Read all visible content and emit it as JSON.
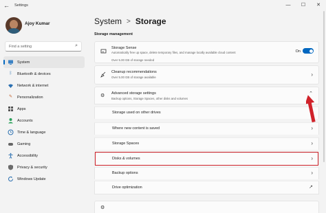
{
  "window": {
    "title": "Settings"
  },
  "user": {
    "name": "Ajoy Kumar"
  },
  "search": {
    "placeholder": "Find a setting"
  },
  "nav": [
    {
      "label": "System",
      "icon": "monitor-icon",
      "active": true
    },
    {
      "label": "Bluetooth & devices",
      "icon": "bluetooth-icon"
    },
    {
      "label": "Network & internet",
      "icon": "wifi-icon"
    },
    {
      "label": "Personalization",
      "icon": "brush-icon"
    },
    {
      "label": "Apps",
      "icon": "apps-icon"
    },
    {
      "label": "Accounts",
      "icon": "person-icon"
    },
    {
      "label": "Time & language",
      "icon": "clock-icon"
    },
    {
      "label": "Gaming",
      "icon": "gamepad-icon"
    },
    {
      "label": "Accessibility",
      "icon": "accessibility-icon"
    },
    {
      "label": "Privacy & security",
      "icon": "shield-icon"
    },
    {
      "label": "Windows Update",
      "icon": "update-icon"
    }
  ],
  "breadcrumb": {
    "parent": "System",
    "separator": ">",
    "current": "Storage"
  },
  "section_title": "Storage management",
  "storage_sense": {
    "title": "Storage Sense",
    "description": "Automatically free up space, delete temporary files, and manage locally available cloud content",
    "description_line2": "Over 5.00 GB of storage needed",
    "toggle_label": "On"
  },
  "cleanup": {
    "title": "Cleanup recommendations",
    "description": "Over 5.00 GB of storage available"
  },
  "advanced": {
    "title": "Advanced storage settings",
    "description": "Backup options, Storage Spaces, other disks and volumes",
    "items": [
      "Storage used on other drives",
      "Where new content is saved",
      "Storage Spaces",
      "Disks & volumes",
      "Backup options",
      "Drive optimization"
    ]
  },
  "colors": {
    "accent": "#0067c0",
    "highlight": "#d0222a"
  }
}
